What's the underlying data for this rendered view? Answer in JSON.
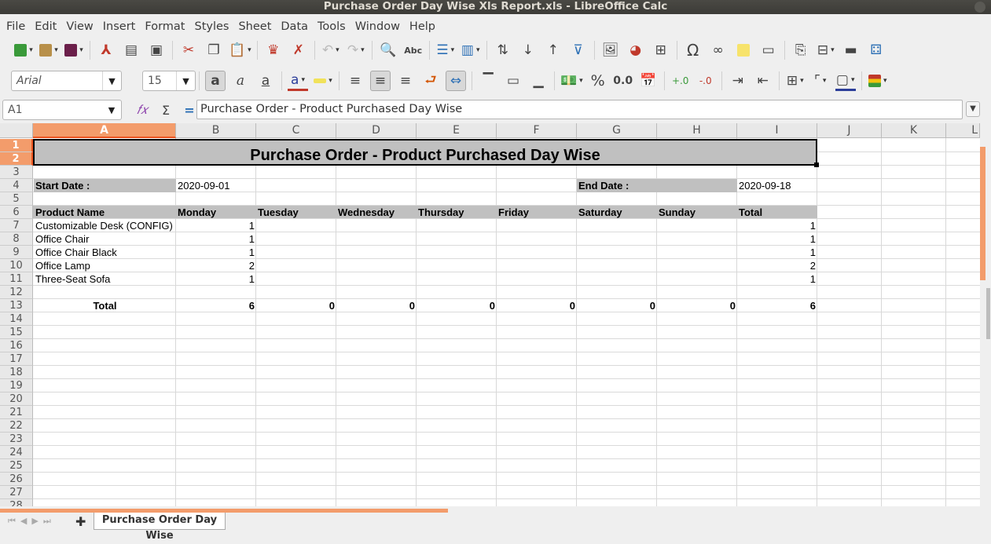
{
  "window": {
    "title": "Purchase Order Day Wise Xls Report.xls - LibreOffice Calc"
  },
  "menu": [
    "File",
    "Edit",
    "View",
    "Insert",
    "Format",
    "Styles",
    "Sheet",
    "Data",
    "Tools",
    "Window",
    "Help"
  ],
  "format_bar": {
    "font_name": "Arial",
    "font_size": "15",
    "number_format_percent": "%",
    "number_format_decimal": "0.0"
  },
  "formula_bar": {
    "cell_ref": "A1",
    "content": "Purchase Order - Product Purchased Day Wise",
    "sum_symbol": "Σ",
    "equals_symbol": "="
  },
  "columns": [
    "A",
    "B",
    "C",
    "D",
    "E",
    "F",
    "G",
    "H",
    "I",
    "J",
    "K",
    "L"
  ],
  "rows": [
    "1",
    "2",
    "3",
    "4",
    "5",
    "6",
    "7",
    "8",
    "9",
    "10",
    "11",
    "12",
    "13",
    "14",
    "15",
    "16",
    "17",
    "18",
    "19",
    "20",
    "21",
    "22",
    "23",
    "24",
    "25",
    "26",
    "27",
    "28"
  ],
  "sheet": {
    "title": "Purchase Order - Product Purchased Day Wise",
    "start_date_label": "Start Date :",
    "start_date": "2020-09-01",
    "end_date_label": "End Date :",
    "end_date": "2020-09-18",
    "headers": [
      "Product Name",
      "Monday",
      "Tuesday",
      "Wednesday",
      "Thursday",
      "Friday",
      "Saturday",
      "Sunday",
      "Total"
    ],
    "products": [
      {
        "name": "Customizable Desk (CONFIG)",
        "monday": "1",
        "total": "1"
      },
      {
        "name": "Office Chair",
        "monday": "1",
        "total": "1"
      },
      {
        "name": "Office Chair Black",
        "monday": "1",
        "total": "1"
      },
      {
        "name": "Office Lamp",
        "monday": "2",
        "total": "2"
      },
      {
        "name": "Three-Seat Sofa",
        "monday": "1",
        "total": "1"
      }
    ],
    "totals_label": "Total",
    "totals": [
      "6",
      "0",
      "0",
      "0",
      "0",
      "0",
      "0",
      "6"
    ]
  },
  "tabs": {
    "active": "Purchase Order Day Wise",
    "add_symbol": "✚"
  },
  "colors": {
    "accent": "#e95420",
    "header_gray": "#c0c0c0"
  }
}
